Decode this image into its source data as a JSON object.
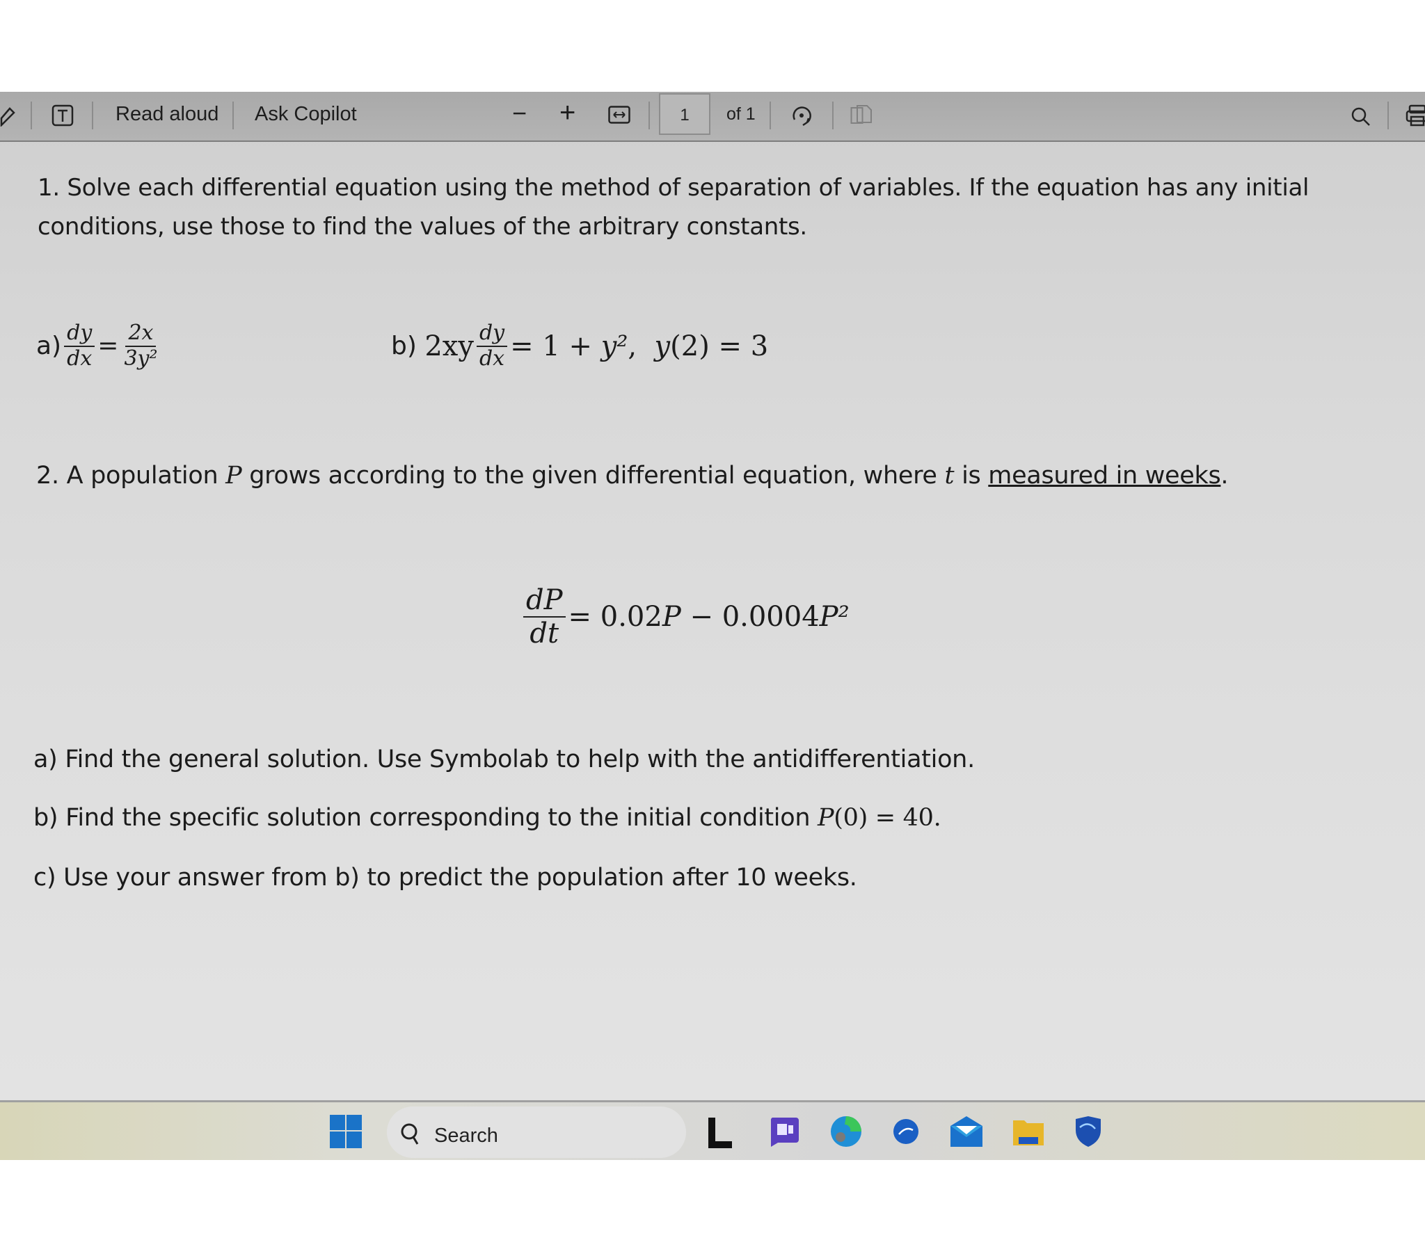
{
  "toolbar": {
    "draw_icon": "pen-icon",
    "text_icon": "text-box-icon",
    "read_aloud": "Read aloud",
    "ask_copilot": "Ask Copilot",
    "zoom_out": "−",
    "zoom_in": "+",
    "fit_width_icon": "fit-width-icon",
    "page_current": "1",
    "page_total": "of 1",
    "rotate_icon": "rotate-icon",
    "page_view_icon": "page-view-icon",
    "search_icon": "search-icon",
    "print_icon": "print-icon"
  },
  "document": {
    "q1_text": "1. Solve each differential equation using the method of separation of variables. If the equation has any initial conditions, use those to find the values of the arbitrary constants.",
    "q1_a": {
      "label": "a)",
      "lhs_num": "dy",
      "lhs_den": "dx",
      "eq": "=",
      "rhs_num": "2x",
      "rhs_den": "3y²"
    },
    "q1_b": {
      "label": "b) ",
      "coef": "2xy",
      "num": "dy",
      "den": "dx",
      "rhs": "= 1 + ",
      "rhs_var": "y²",
      "sep": ",  ",
      "cond_var": "y",
      "cond": "(2) = 3"
    },
    "q2_intro_1": "2. A population ",
    "q2_var_P": "P",
    "q2_intro_2": " grows according to the given differential equation, where ",
    "q2_var_t": "t",
    "q2_intro_3": " is ",
    "q2_underlined": "measured in weeks",
    "q2_end": ".",
    "q2_eq": {
      "num": "dP",
      "den": "dt",
      "rhs_1": "= 0.02",
      "var1": "P",
      "rhs_2": " − 0.0004",
      "var2": "P²"
    },
    "parts": {
      "a": "a) Find the general solution. Use Symbolab to help with the antidifferentiation.",
      "b_text": "b) Find the specific solution corresponding to the initial condition ",
      "b_var": "P",
      "b_cond": "(0) = 40.",
      "c": "c) Use your answer from b) to predict the population after 10 weeks."
    }
  },
  "taskbar": {
    "start_icon": "windows-start-icon",
    "search_label": "Search",
    "apps": [
      {
        "name": "app-l-icon",
        "color": "#111111"
      },
      {
        "name": "teams-chat-icon",
        "color": "#5a3fc0"
      },
      {
        "name": "edge-icon",
        "color": "#1f8fd6"
      },
      {
        "name": "app-blue-circle-icon",
        "color": "#1a5fc4"
      },
      {
        "name": "mail-icon",
        "color": "#1a72cc"
      },
      {
        "name": "file-explorer-icon",
        "color": "#e7b62a"
      },
      {
        "name": "shield-app-icon",
        "color": "#1c4fb0"
      }
    ]
  }
}
